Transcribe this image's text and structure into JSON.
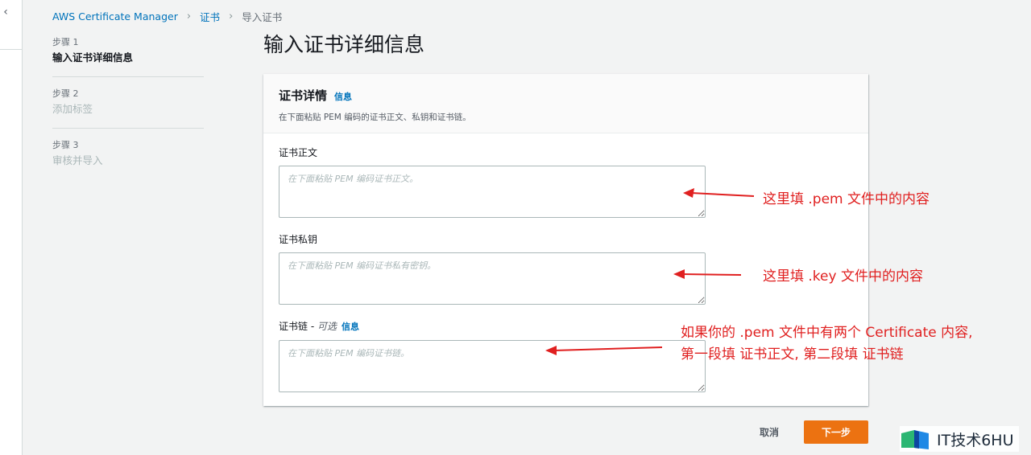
{
  "breadcrumb": {
    "items": [
      "AWS Certificate Manager",
      "证书",
      "导入证书"
    ]
  },
  "steps": [
    {
      "number": "步骤 1",
      "label": "输入证书详细信息"
    },
    {
      "number": "步骤 2",
      "label": "添加标签"
    },
    {
      "number": "步骤 3",
      "label": "审核并导入"
    }
  ],
  "page_title": "输入证书详细信息",
  "panel": {
    "title": "证书详情",
    "info_link": "信息",
    "description": "在下面粘贴 PEM 编码的证书正文、私钥和证书链。",
    "fields": [
      {
        "label": "证书正文",
        "placeholder": "在下面粘贴 PEM 编码证书正文。"
      },
      {
        "label": "证书私钥",
        "placeholder": "在下面粘贴 PEM 编码证书私有密钥。"
      },
      {
        "label": "证书链 - ",
        "optional": "可选",
        "info_link": "信息",
        "placeholder": "在下面粘贴 PEM 编码证书链。"
      }
    ]
  },
  "actions": {
    "cancel": "取消",
    "next": "下一步"
  },
  "annotations": {
    "a1": "这里填 .pem 文件中的内容",
    "a2": "这里填 .key 文件中的内容",
    "a3_line1": "如果你的 .pem 文件中有两个 Certificate 内容,",
    "a3_line2": "第一段填 证书正文, 第二段填 证书链"
  },
  "watermark": {
    "text": "IT技术6HU"
  },
  "colors": {
    "link": "#0073bb",
    "primary": "#ec7211",
    "annotation": "#e02020"
  },
  "icons": {
    "rail": "chevron-left-icon",
    "breadcrumb_separator": "chevron-right-icon",
    "watermark": "book-logo-icon"
  }
}
